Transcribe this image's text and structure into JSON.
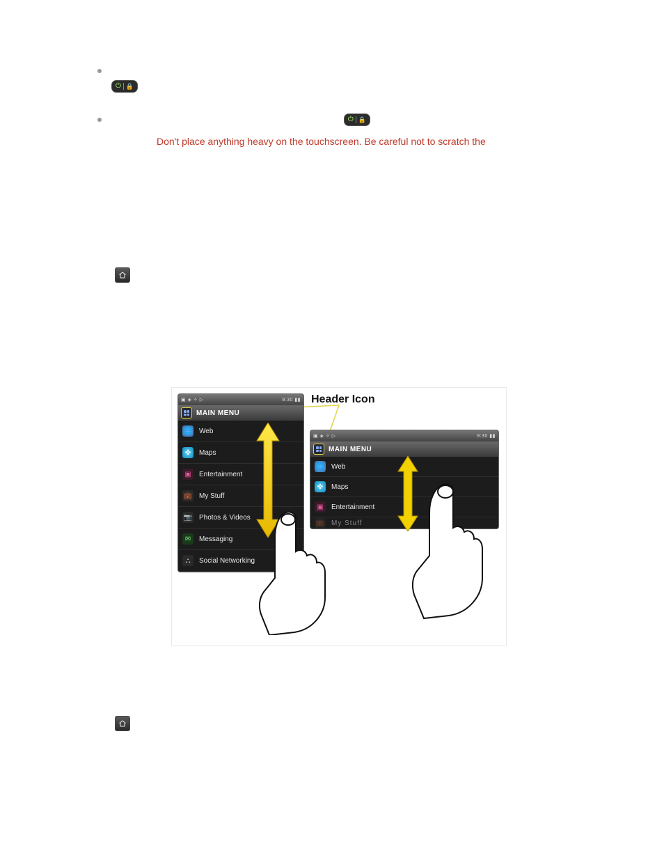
{
  "bullets": {
    "b1_prefix": "",
    "b1_rest_hidden": "",
    "b2_prefix": "",
    "b2_rest_hidden": ""
  },
  "inline_badges": {
    "power_lock": "power / lock key"
  },
  "warning": "Don't place anything heavy on the touchscreen. Be careful not to scratch the",
  "figure": {
    "header_label": "Header Icon",
    "title": "MAIN MENU",
    "status_left": "▣ ◈ ✧ ▷",
    "status_right": "9:30 ▮▮",
    "items": [
      {
        "key": "web",
        "label": "Web"
      },
      {
        "key": "maps",
        "label": "Maps"
      },
      {
        "key": "ent",
        "label": "Entertainment"
      },
      {
        "key": "stuff",
        "label": "My Stuff"
      },
      {
        "key": "pv",
        "label": "Photos & Videos"
      },
      {
        "key": "msg",
        "label": "Messaging"
      },
      {
        "key": "soc",
        "label": "Social Networking"
      }
    ],
    "landscape_visible": [
      "web",
      "maps",
      "ent"
    ],
    "landscape_partial_label": "My Stuff"
  },
  "colors": {
    "warning": "#c0392b",
    "callout_yellow": "#e2d24a",
    "arrow_yellow": "#f2d100"
  }
}
